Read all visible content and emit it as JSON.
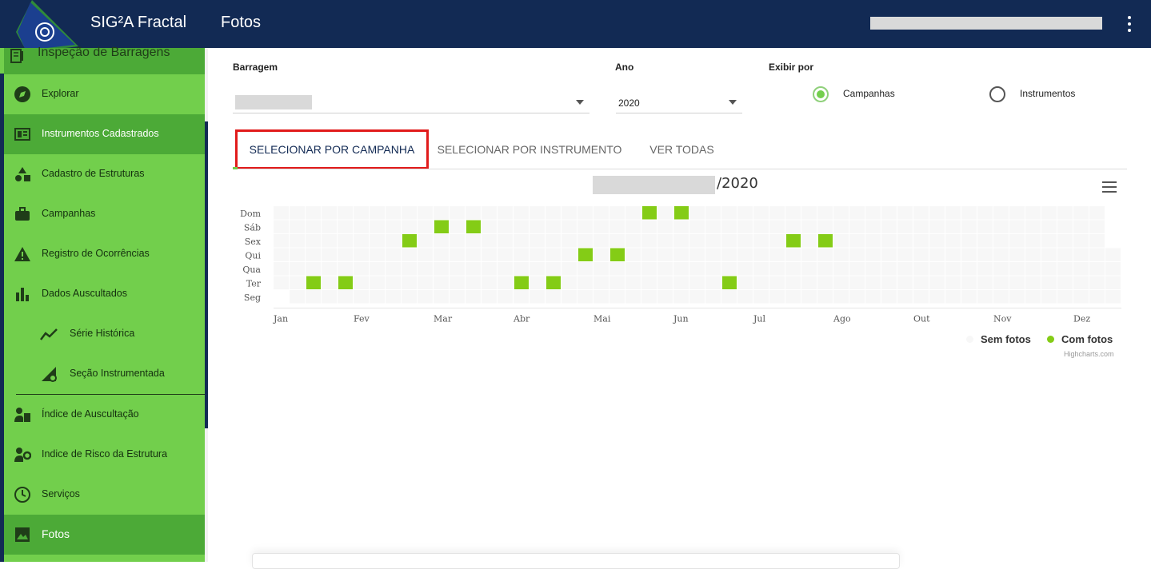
{
  "header": {
    "app_title": "SIG²A Fractal",
    "page_title": "Fotos",
    "background": "#122a54"
  },
  "sidebar": {
    "header_label": "Inspeção de Barragens",
    "accent": "#72cf4c",
    "active_accent": "#4caa37",
    "items": [
      {
        "label": "Explorar",
        "icon": "compass-icon"
      },
      {
        "label": "Instrumentos Cadastrados",
        "icon": "instrument-panel-icon",
        "active": true
      },
      {
        "label": "Cadastro de Estruturas",
        "icon": "shapes-icon"
      },
      {
        "label": "Campanhas",
        "icon": "briefcase-icon"
      },
      {
        "label": "Registro de Ocorrências",
        "icon": "warning-icon"
      },
      {
        "label": "Dados Auscultados",
        "icon": "bar-chart-icon"
      },
      {
        "label": "Série Histórica",
        "icon": "trend-line-icon"
      },
      {
        "label": "Seção Instrumentada",
        "icon": "section-gear-icon"
      },
      {
        "label": "Índice de Auscultação",
        "icon": "person-document-icon"
      },
      {
        "label": "Indice de Risco da Estrutura",
        "icon": "person-gear-icon"
      },
      {
        "label": "Serviços",
        "icon": "clock-icon"
      },
      {
        "label": "Fotos",
        "icon": "image-icon",
        "active": true
      }
    ]
  },
  "filters": {
    "barragem": {
      "label": "Barragem",
      "value": ""
    },
    "ano": {
      "label": "Ano",
      "value": "2020"
    },
    "exibir_por": {
      "label": "Exibir por",
      "options": [
        {
          "label": "Campanhas",
          "checked": true
        },
        {
          "label": "Instrumentos",
          "checked": false
        }
      ]
    }
  },
  "tabs": [
    {
      "label": "SELECIONAR POR CAMPANHA",
      "active": true
    },
    {
      "label": "SELECIONAR POR INSTRUMENTO",
      "active": false
    },
    {
      "label": "VER TODAS",
      "active": false
    }
  ],
  "chart_data": {
    "type": "heatmap",
    "title": "/2020",
    "x_tick_labels": [
      "Jan",
      "Fev",
      "Mar",
      "Abr",
      "Mai",
      "Jun",
      "Jul",
      "Ago",
      "Out",
      "Nov",
      "Dez"
    ],
    "y_categories": [
      "Dom",
      "Sáb",
      "Sex",
      "Qui",
      "Qua",
      "Ter",
      "Seg"
    ],
    "weeks": 53,
    "legend": [
      {
        "name": "Sem fotos",
        "color": "#f7f7f7"
      },
      {
        "name": "Com fotos",
        "color": "#84cc16"
      }
    ],
    "credits": "Highcharts.com",
    "photo_cells": [
      {
        "week": 2,
        "day": "Ter"
      },
      {
        "week": 4,
        "day": "Ter"
      },
      {
        "week": 8,
        "day": "Sex"
      },
      {
        "week": 10,
        "day": "Sáb"
      },
      {
        "week": 12,
        "day": "Sáb"
      },
      {
        "week": 15,
        "day": "Ter"
      },
      {
        "week": 17,
        "day": "Ter"
      },
      {
        "week": 19,
        "day": "Qui"
      },
      {
        "week": 21,
        "day": "Qui"
      },
      {
        "week": 23,
        "day": "Dom"
      },
      {
        "week": 25,
        "day": "Dom"
      },
      {
        "week": 28,
        "day": "Ter"
      },
      {
        "week": 32,
        "day": "Sex"
      },
      {
        "week": 34,
        "day": "Sex"
      }
    ]
  }
}
